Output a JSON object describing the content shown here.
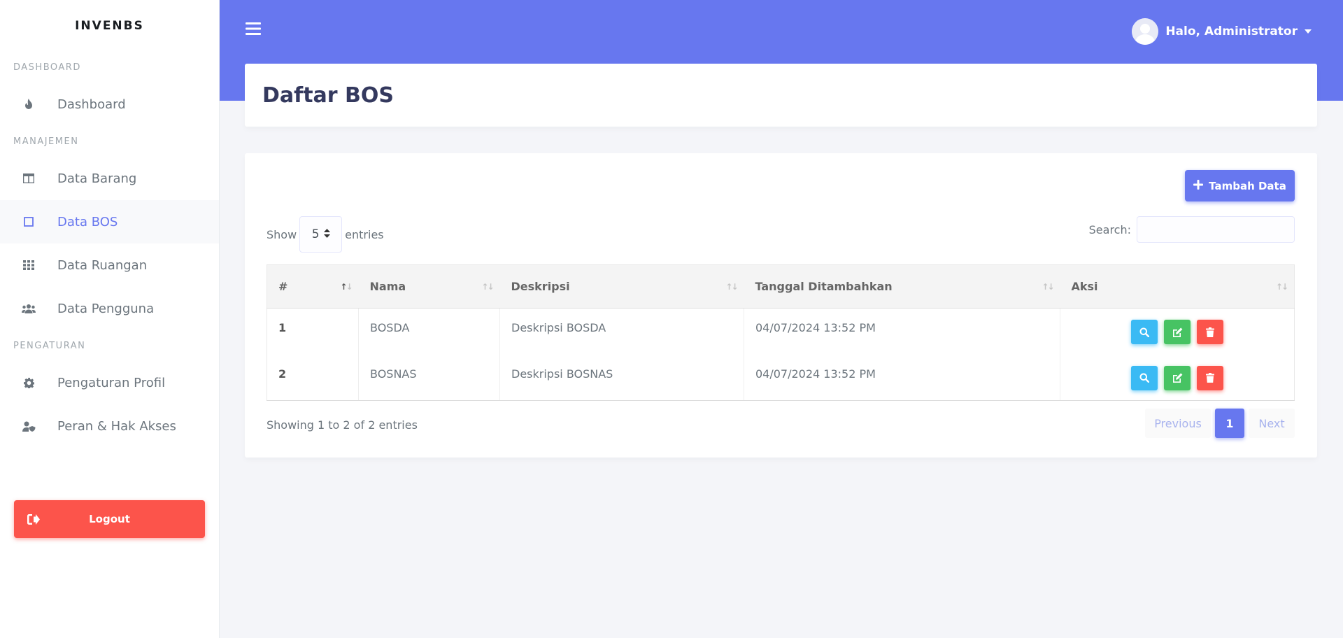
{
  "sidebar": {
    "brand": "INVENBS",
    "sections": [
      {
        "header": "DASHBOARD"
      },
      {
        "header": "MANAJEMEN"
      },
      {
        "header": "PENGATURAN"
      }
    ],
    "items": {
      "dashboard": {
        "label": "Dashboard",
        "icon": "fire-icon"
      },
      "data_barang": {
        "label": "Data Barang",
        "icon": "columns-icon"
      },
      "data_bos": {
        "label": "Data BOS",
        "icon": "square-icon",
        "active": true
      },
      "data_ruangan": {
        "label": "Data Ruangan",
        "icon": "th-icon"
      },
      "data_pengguna": {
        "label": "Data Pengguna",
        "icon": "users-icon"
      },
      "pengaturan_profil": {
        "label": "Pengaturan Profil",
        "icon": "gear-icon"
      },
      "peran_hak_akses": {
        "label": "Peran & Hak Akses",
        "icon": "user-shield-icon"
      }
    },
    "logout_label": "Logout"
  },
  "topbar": {
    "user_greeting": "Halo, Administrator"
  },
  "page": {
    "title": "Daftar BOS",
    "add_button": "Tambah Data",
    "show_label": "Show",
    "entries_value": "5",
    "entries_label": "entries",
    "search_label": "Search:",
    "search_value": ""
  },
  "table": {
    "columns": [
      "#",
      "Nama",
      "Deskripsi",
      "Tanggal Ditambahkan",
      "Aksi"
    ],
    "rows": [
      {
        "no": "1",
        "nama": "BOSDA",
        "deskripsi": "Deskripsi BOSDA",
        "tanggal": "04/07/2024 13:52 PM"
      },
      {
        "no": "2",
        "nama": "BOSNAS",
        "deskripsi": "Deskripsi BOSNAS",
        "tanggal": "04/07/2024 13:52 PM"
      }
    ]
  },
  "footer": {
    "info": "Showing 1 to 2 of 2 entries",
    "previous": "Previous",
    "current_page": "1",
    "next": "Next"
  },
  "colors": {
    "primary": "#6777ef",
    "danger": "#fc544b",
    "info": "#3abaf4",
    "success": "#47c363"
  }
}
